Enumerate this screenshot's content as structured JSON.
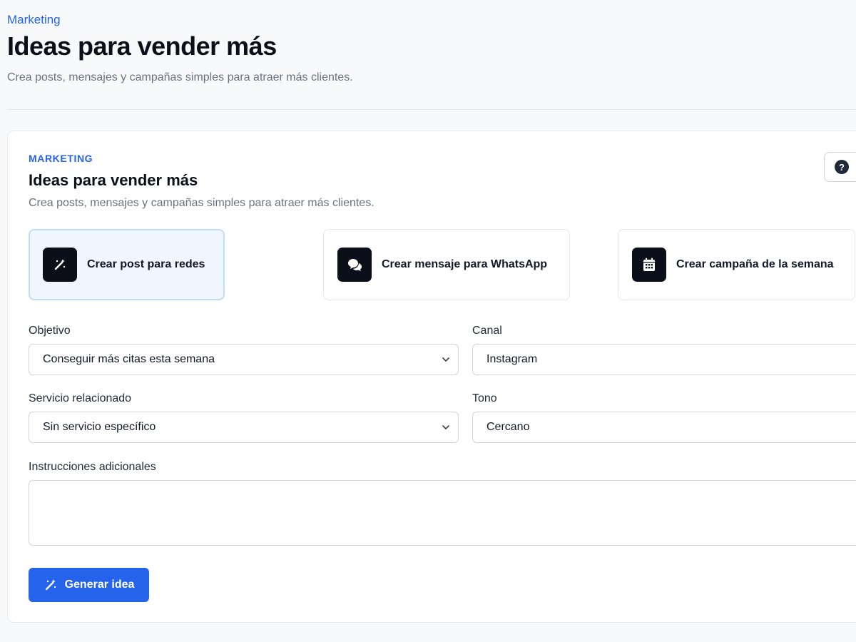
{
  "header": {
    "eyebrow": "Marketing",
    "title": "Ideas para vender más",
    "subtitle": "Crea posts, mensajes y campañas simples para atraer más clientes."
  },
  "card": {
    "eyebrow": "MARKETING",
    "title": "Ideas para vender más",
    "subtitle": "Crea posts, mensajes y campañas simples para atraer más clientes.",
    "help_icon": "question-circle-icon",
    "actions": [
      {
        "label": "Crear post para redes",
        "icon": "magic-wand-icon",
        "active": true
      },
      {
        "label": "Crear mensaje para WhatsApp",
        "icon": "chat-bubbles-icon",
        "active": false
      },
      {
        "label": "Crear campaña de la semana",
        "icon": "calendar-icon",
        "active": false
      }
    ]
  },
  "form": {
    "objetivo": {
      "label": "Objetivo",
      "value": "Conseguir más citas esta semana"
    },
    "canal": {
      "label": "Canal",
      "value": "Instagram"
    },
    "servicio": {
      "label": "Servicio relacionado",
      "value": "Sin servicio específico"
    },
    "tono": {
      "label": "Tono",
      "value": "Cercano"
    },
    "instrucciones": {
      "label": "Instrucciones adicionales",
      "value": ""
    },
    "submit_label": "Generar idea"
  },
  "colors": {
    "accent": "#2563eb",
    "icon_bg": "#0b0f19",
    "active_card_bg": "#eff6ff"
  }
}
